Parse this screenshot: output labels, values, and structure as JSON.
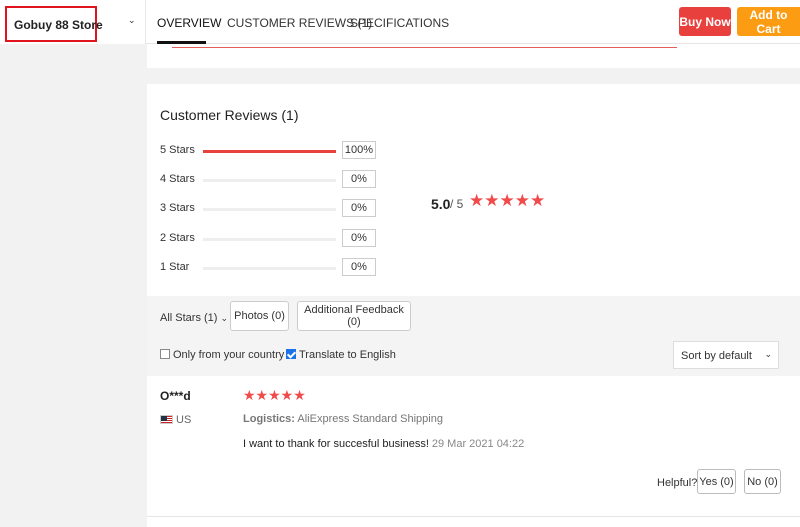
{
  "header": {
    "store_name": "Gobuy 88 Store",
    "tabs": [
      "OVERVIEW",
      "CUSTOMER REVIEWS (1)",
      "SPECIFICATIONS"
    ],
    "active_tab": "OVERVIEW",
    "buy_now": "Buy Now",
    "add_to_cart": "Add to Cart",
    "colors": {
      "buy_now": "#e8403d",
      "add_to_cart": "#fc9c13",
      "store_highlight": "#e0141e"
    }
  },
  "reviews": {
    "title": "Customer Reviews (1)",
    "breakdown": [
      {
        "label": "5 Stars",
        "percent": "100%",
        "fraction": 1.0
      },
      {
        "label": "4 Stars",
        "percent": "0%",
        "fraction": 0
      },
      {
        "label": "3 Stars",
        "percent": "0%",
        "fraction": 0
      },
      {
        "label": "2 Stars",
        "percent": "0%",
        "fraction": 0
      },
      {
        "label": "1 Star",
        "percent": "0%",
        "fraction": 0
      }
    ],
    "average": "5.0",
    "out_of": "/ 5",
    "average_stars": 5,
    "filters": {
      "all_stars": "All Stars (1)",
      "photos": "Photos (0)",
      "additional_feedback": "Additional Feedback (0)",
      "only_from_country": "Only from your country",
      "only_from_country_checked": false,
      "translate": "Translate to English",
      "translate_checked": true,
      "sort": "Sort by default"
    },
    "items": [
      {
        "reviewer": "O***d",
        "country": "US",
        "stars": 5,
        "logistics_label": "Logistics:",
        "logistics_value": "AliExpress Standard Shipping",
        "text": "I want to thank for succesful business!",
        "date": "29 Mar 2021 04:22",
        "helpful_label": "Helpful?",
        "yes": "Yes (0)",
        "no": "No (0)"
      }
    ]
  }
}
